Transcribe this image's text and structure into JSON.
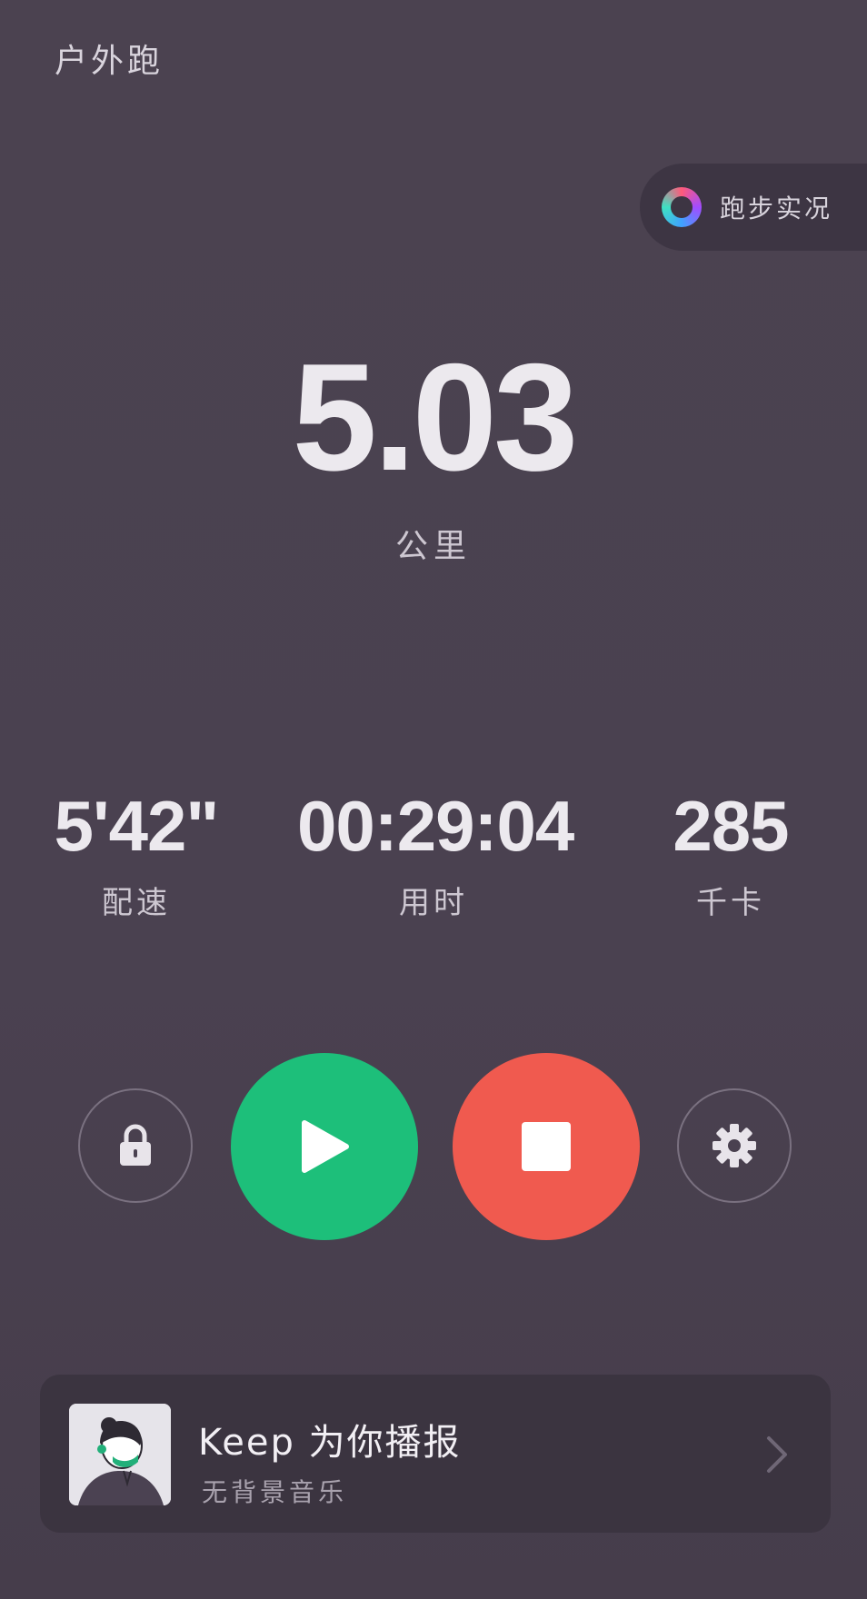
{
  "header": {
    "title": "户外跑"
  },
  "live": {
    "label": "跑步实况",
    "icon": "ring-gradient-icon"
  },
  "distance": {
    "value": "5.03",
    "unit": "公里"
  },
  "stats": [
    {
      "value": "5'42\"",
      "label": "配速"
    },
    {
      "value": "00:29:04",
      "label": "用时"
    },
    {
      "value": "285",
      "label": "千卡"
    }
  ],
  "controls": {
    "lock_icon": "lock-icon",
    "play_icon": "play-icon",
    "stop_icon": "stop-icon",
    "settings_icon": "gear-icon",
    "play_color": "#1dbf7a",
    "stop_color": "#f05a4f"
  },
  "voice_card": {
    "title": "Keep 为你播报",
    "subtitle": "无背景音乐"
  },
  "colors": {
    "background": "#4a4150",
    "card": "#3b3440",
    "text": "#ece9ee"
  }
}
